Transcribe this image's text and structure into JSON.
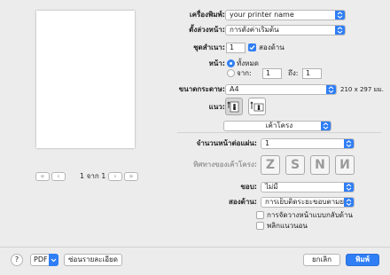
{
  "preview": {
    "page_label": "1 จาก 1",
    "first_label": "«",
    "prev_label": "‹",
    "next_label": "›",
    "last_label": "»"
  },
  "printer": {
    "label": "เครื่องพิมพ์:",
    "value": "your printer name"
  },
  "presets": {
    "label": "ตั้งล่วงหน้า:",
    "value": "การตั้งค่าเริ่มต้น"
  },
  "copies": {
    "label": "ชุดสำเนา:",
    "value": "1",
    "two_sided_label": "สองด้าน",
    "two_sided_checked": true
  },
  "pages": {
    "label": "หน้า:",
    "all_label": "ทั้งหมด",
    "from_label": "จาก:",
    "from_value": "1",
    "to_label": "ถึง:",
    "to_value": "1",
    "selected": "all"
  },
  "paper_size": {
    "label": "ขนาดกระดาษ:",
    "value": "A4",
    "dimensions": "210 x 297 มม."
  },
  "orientation": {
    "label": "แนว:",
    "selected": "portrait"
  },
  "section_popup": {
    "value": "เค้าโครง"
  },
  "pages_per_sheet": {
    "label": "จำนวนหน้าต่อแผ่น:",
    "value": "1"
  },
  "layout_direction": {
    "label": "ทิศทางของเค้าโครง:"
  },
  "border": {
    "label": "ขอบ:",
    "value": "ไม่มี"
  },
  "two_sided_binding": {
    "label": "สองด้าน:",
    "value": "การเย็บติดระยะขอบตามยาว"
  },
  "options": {
    "reverse_label": "การจัดวางหน้าแบบกลับด้าน",
    "reverse_checked": false,
    "flip_label": "พลิกแนวนอน",
    "flip_checked": false
  },
  "footer": {
    "help_label": "?",
    "pdf_label": "PDF",
    "hide_details_label": "ซ่อนรายละเอียด",
    "cancel_label": "ยกเลิก",
    "print_label": "พิมพ์"
  },
  "colors": {
    "accent": "#2f7ef5",
    "background": "#ececec"
  }
}
